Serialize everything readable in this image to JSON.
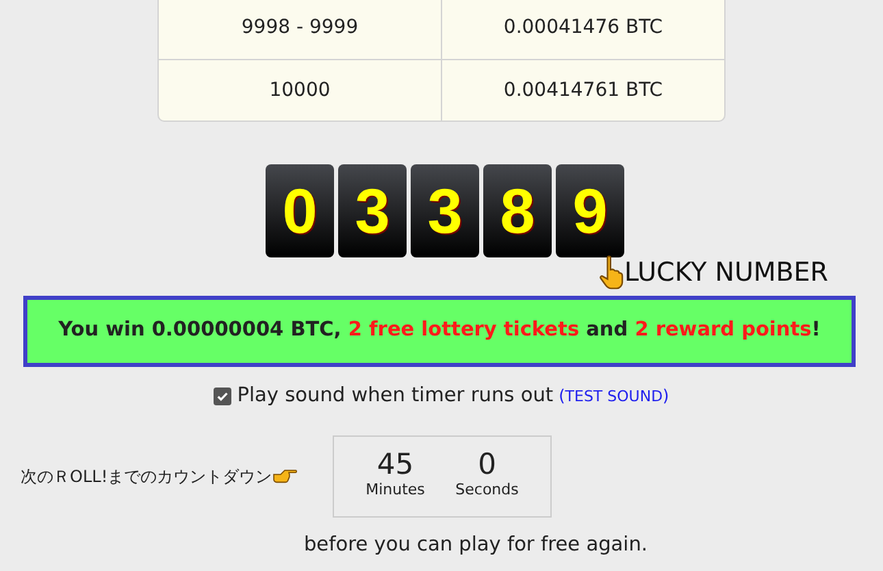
{
  "payout_table": {
    "rows": [
      {
        "range": "9998 - 9999",
        "payout": "0.00041476 BTC"
      },
      {
        "range": "10000",
        "payout": "0.00414761 BTC"
      }
    ]
  },
  "lucky_number": {
    "digits": [
      "0",
      "3",
      "3",
      "8",
      "9"
    ],
    "label": "LUCKY NUMBER"
  },
  "win_message": {
    "segments": [
      {
        "text": "You win 0.00000004 BTC, ",
        "kind": "plain"
      },
      {
        "text": "2 free lottery tickets",
        "kind": "highlight"
      },
      {
        "text": " and ",
        "kind": "plain"
      },
      {
        "text": "2 reward points",
        "kind": "highlight"
      },
      {
        "text": "!",
        "kind": "plain"
      }
    ]
  },
  "sound_option": {
    "label": "Play sound when timer runs out",
    "checked": true,
    "link_open": "(",
    "link": "TEST SOUND",
    "link_close": ")"
  },
  "countdown": {
    "label": "次のＲOLL!までのカウントダウン",
    "units": [
      {
        "value": "45",
        "unit": "Minutes"
      },
      {
        "value": "0",
        "unit": "Seconds"
      }
    ]
  },
  "footer_text": "before you can play for free again."
}
